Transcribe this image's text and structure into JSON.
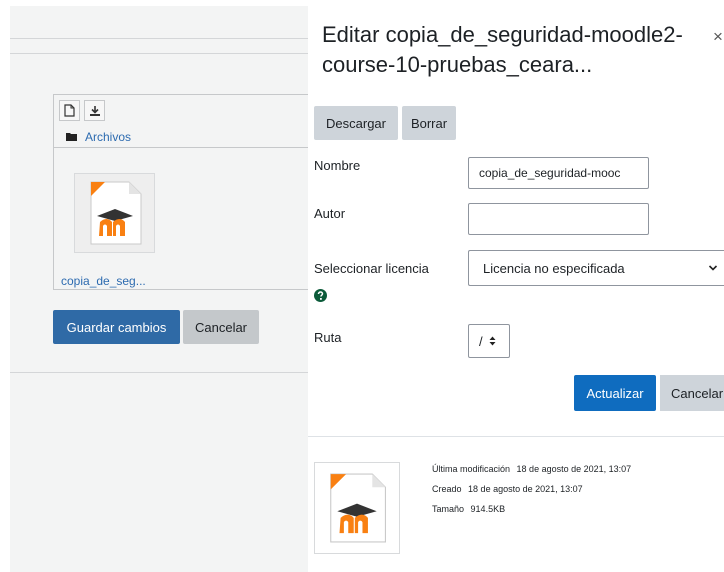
{
  "filemanager": {
    "folder_name": "Archivos",
    "file_name": "copia_de_seg..."
  },
  "background_form": {
    "save_label": "Guardar cambios",
    "cancel_label": "Cancelar"
  },
  "dialog": {
    "title": "Editar copia_de_seguridad-moodle2-course-10-pruebas_ceara...",
    "close_label": "×",
    "download_label": "Descargar",
    "delete_label": "Borrar",
    "name_label": "Nombre",
    "name_value": "copia_de_seguridad-mooc",
    "author_label": "Autor",
    "author_value": "",
    "licence_label": "Seleccionar licencia",
    "licence_value": "Licencia no especificada",
    "path_label": "Ruta",
    "path_value": "/",
    "update_label": "Actualizar",
    "cancel_label": "Cancelar",
    "modified_label": "Última modificación",
    "modified_value": "18 de agosto de 2021, 13:07",
    "created_label": "Creado",
    "created_value": "18 de agosto de 2021, 13:07",
    "size_label": "Tamaño",
    "size_value": "914.5KB"
  },
  "colors": {
    "primary": "#0f6cbf",
    "link": "#2d6bb0",
    "moodle_orange": "#f98012",
    "help_green": "#0c5b3a"
  },
  "icons": [
    "new-file-icon",
    "download-icon",
    "folder-icon",
    "moodle-file-icon",
    "close-icon",
    "chevron-down-icon",
    "help-icon",
    "sort-arrows-icon"
  ]
}
